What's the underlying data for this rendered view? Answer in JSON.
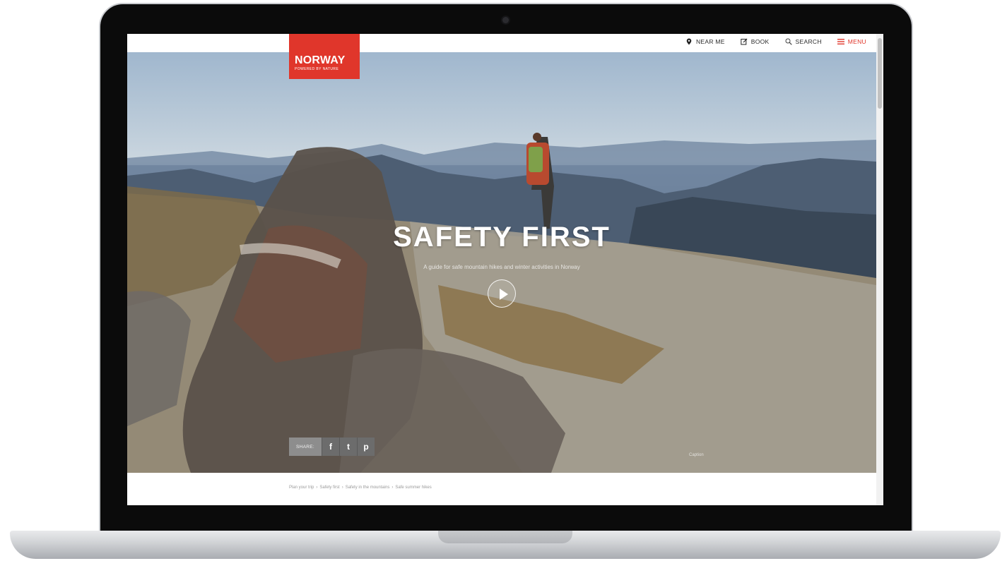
{
  "nav": {
    "near_me": "NEAR ME",
    "book": "BOOK",
    "search": "SEARCH",
    "menu": "MENU"
  },
  "logo": {
    "title": "NORWAY",
    "subtitle": "POWERED BY NATURE"
  },
  "hero": {
    "heading": "SAFETY FIRST",
    "subheading": "A guide for safe mountain hikes and winter activities in Norway",
    "caption": "Caption"
  },
  "share": {
    "label": "SHARE:",
    "facebook": "f",
    "twitter": "t",
    "pinterest": "p"
  },
  "breadcrumb": {
    "items": [
      "Plan your trip",
      "Safety first",
      "Safety in the mountains",
      "Safe summer hikes"
    ],
    "separator": "›"
  },
  "colors": {
    "accent": "#e0362b",
    "share_bg": "#6c6c6c"
  }
}
